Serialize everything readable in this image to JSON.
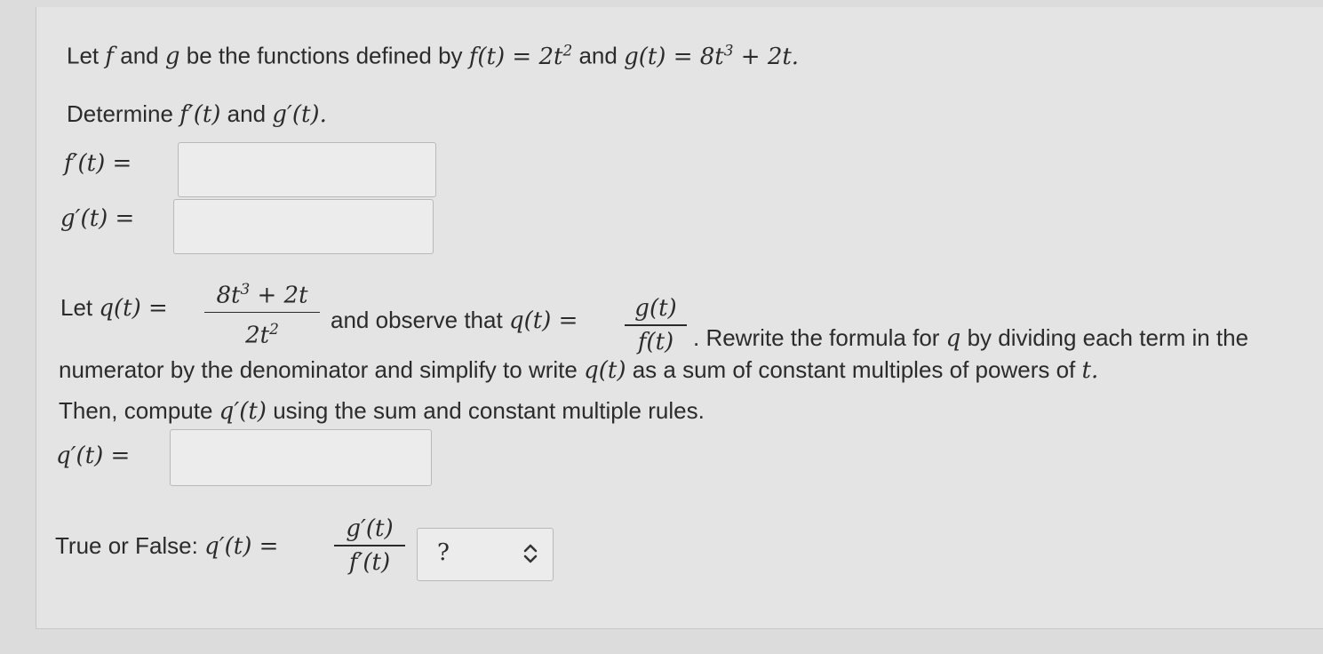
{
  "intro": {
    "prefix": "Let",
    "f": "f",
    "and1": "and",
    "g": "g",
    "middle": "be the functions defined by",
    "f_def": "f(t) = 2t",
    "f_exp": "2",
    "and2": "and",
    "g_def": "g(t) = 8t",
    "g_exp": "3",
    "g_tail": "+ 2t."
  },
  "determine": {
    "text": "Determine",
    "fp": "f′(t)",
    "and": "and",
    "gp": "g′(t)."
  },
  "fields": {
    "fprime_label": "f′(t) =",
    "gprime_label": "g′(t) =",
    "qprime_label": "q′(t) =",
    "fprime_value": "",
    "gprime_value": "",
    "qprime_value": ""
  },
  "qdef": {
    "let": "Let",
    "q_lhs": "q(t) =",
    "num_a": "8t",
    "num_exp": "3",
    "num_b": " + 2t",
    "den_a": "2t",
    "den_exp": "2",
    "observe": "and observe that",
    "q_lhs2": "q(t) =",
    "frac2_num": "g(t)",
    "frac2_den": "f(t)",
    "rewrite": ". Rewrite the formula for",
    "q": "q",
    "rewrite_tail": "by dividing each term in the"
  },
  "para": {
    "line2a": "numerator by the denominator and simplify to write",
    "line2q": "q(t)",
    "line2b": "as a sum of constant multiples of powers of",
    "line2t": "t.",
    "line3a": "Then, compute",
    "line3q": "q′(t)",
    "line3b": "using the sum and constant multiple rules."
  },
  "truefalse": {
    "label": "True or False:",
    "lhs": "q′(t) =",
    "num": "g′(t)",
    "den": "f′(t)",
    "selected": "?"
  }
}
